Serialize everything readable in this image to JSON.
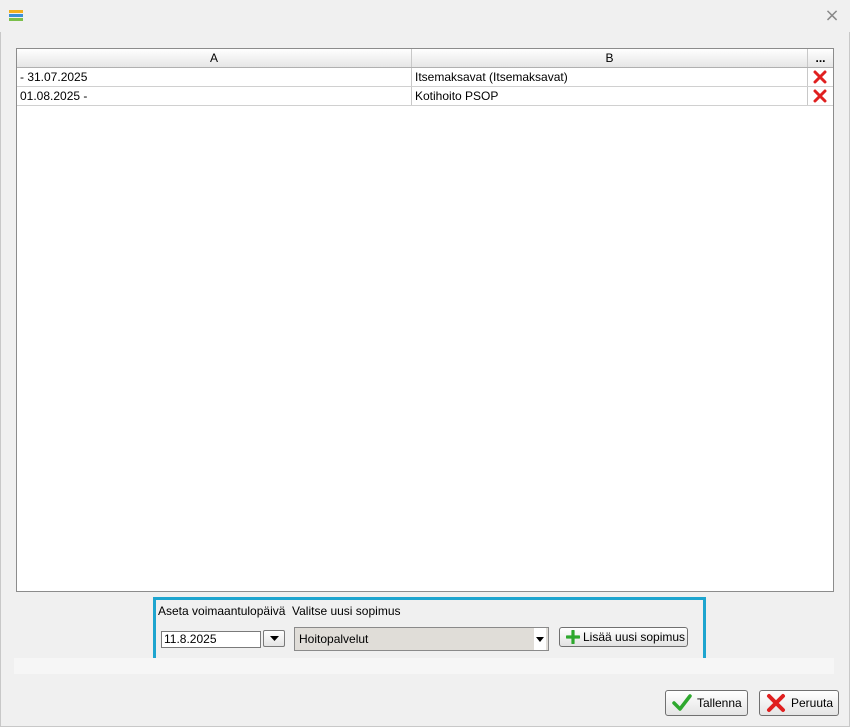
{
  "grid": {
    "columns": [
      "A",
      "B",
      "..."
    ],
    "rows": [
      {
        "a": " - 31.07.2025",
        "b": "Itsemaksavat (Itsemaksavat)"
      },
      {
        "a": "01.08.2025 -",
        "b": "Kotihoito PSOP"
      }
    ]
  },
  "panel": {
    "date_label": "Aseta voimaantulopäivä",
    "contract_label": "Valitse uusi sopimus",
    "date_value": "11.8.2025",
    "contract_value": "Hoitopalvelut",
    "add_label": "Lisää uusi sopimus"
  },
  "buttons": {
    "save": "Tallenna",
    "cancel": "Peruuta"
  },
  "colors": {
    "accent_border": "#1ea5cf",
    "delete_red": "#e02020",
    "check_green": "#2ea82e"
  },
  "icons": [
    "app-icon",
    "close-icon",
    "delete-icon",
    "dropdown-arrow-icon",
    "plus-icon",
    "checkmark-icon",
    "cross-icon"
  ]
}
